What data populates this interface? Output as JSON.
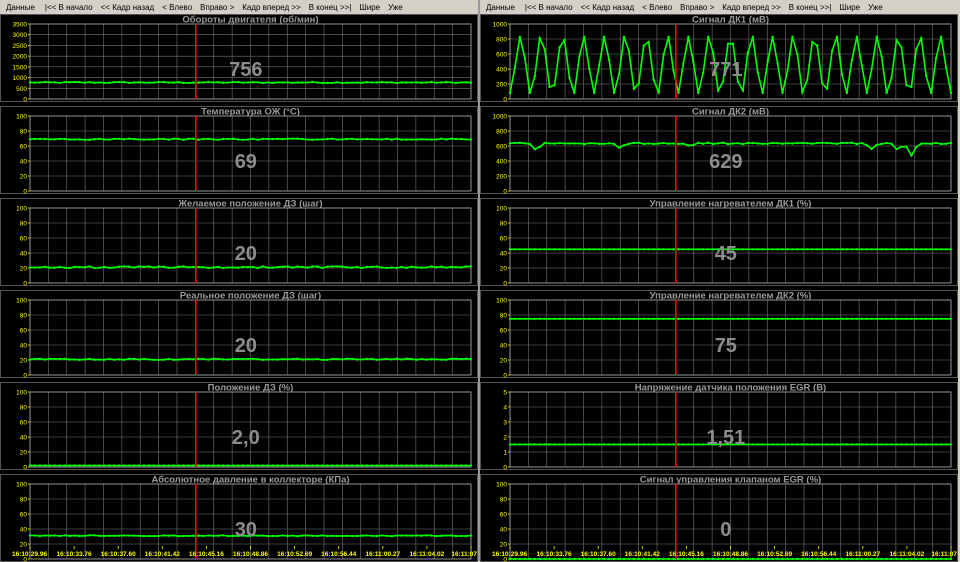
{
  "toolbar": {
    "items": [
      "Данные",
      "|<< В начало",
      "<< Кадр назад",
      "< Влево",
      "Вправо >",
      "Кадр вперед >>",
      "В конец >>|",
      "Шире",
      "Уже"
    ]
  },
  "time_axis": {
    "labels": [
      "16:10:29.96",
      "16:10:33.76",
      "16:10:37.60",
      "16:10:41.42",
      "16:10:45.16",
      "16:10:48.86",
      "16:10:52.69",
      "16:10:56.44",
      "16:11:00.27",
      "16:11:04.02",
      "16:11:07"
    ]
  },
  "cursor": {
    "position": 0.376,
    "color": "#ff0000"
  },
  "colors": {
    "trace": "#00ff00",
    "value": "#8c8c8c",
    "title": "#9a9a9a",
    "grid": "#777777",
    "tick": "#ffff00"
  },
  "chart_data": [
    {
      "id": "rpm",
      "type": "line",
      "title": "Обороты двигателя  (об/мин)",
      "value_text": "756",
      "ylim": [
        0,
        3500
      ],
      "yticks": [
        "3500",
        "3000",
        "2500",
        "2000",
        "1500",
        "1000",
        "500",
        "0"
      ],
      "grid": true,
      "pattern": "flat",
      "level": 770,
      "noise": 25
    },
    {
      "id": "coolant",
      "type": "line",
      "title": "Температура ОЖ  (°С)",
      "value_text": "69",
      "ylim": [
        0,
        100
      ],
      "yticks": [
        "100",
        "80",
        "60",
        "40",
        "20",
        "0"
      ],
      "grid": true,
      "pattern": "flat",
      "level": 69,
      "noise": 0.8
    },
    {
      "id": "dz-desired",
      "type": "line",
      "title": "Желаемое положение ДЗ  (шаг)",
      "value_text": "20",
      "ylim": [
        0,
        100
      ],
      "yticks": [
        "100",
        "80",
        "60",
        "40",
        "20",
        "0"
      ],
      "grid": true,
      "pattern": "flat",
      "level": 21,
      "noise": 1.2
    },
    {
      "id": "dz-actual",
      "type": "line",
      "title": "Реальное положение ДЗ  (шаг)",
      "value_text": "20",
      "ylim": [
        0,
        100
      ],
      "yticks": [
        "100",
        "80",
        "60",
        "40",
        "20",
        "0"
      ],
      "grid": true,
      "pattern": "flat",
      "level": 21,
      "noise": 0.8
    },
    {
      "id": "dz-position",
      "type": "line",
      "title": "Положение ДЗ  (%)",
      "value_text": "2,0",
      "ylim": [
        0,
        100
      ],
      "yticks": [
        "100",
        "80",
        "60",
        "40",
        "20",
        "0"
      ],
      "grid": true,
      "pattern": "flat",
      "level": 2,
      "noise": 0
    },
    {
      "id": "map",
      "type": "line",
      "title": "Абсолютное давление в коллекторе  (КПа)",
      "value_text": "30",
      "ylim": [
        0,
        100
      ],
      "yticks": [
        "100",
        "80",
        "60",
        "40",
        "20",
        "0"
      ],
      "grid": true,
      "pattern": "flat",
      "level": 31,
      "noise": 0.6
    },
    {
      "id": "o2-1",
      "type": "line",
      "title": "Сигнал ДК1  (мВ)",
      "value_text": "771",
      "ylim": [
        0,
        1000
      ],
      "yticks": [
        "1000",
        "800",
        "600",
        "400",
        "200",
        "0"
      ],
      "grid": true,
      "pattern": "oscillate",
      "low": 80,
      "high": 830,
      "cycles": 21
    },
    {
      "id": "o2-2",
      "type": "line",
      "title": "Сигнал ДК2  (мВ)",
      "value_text": "629",
      "ylim": [
        0,
        1000
      ],
      "yticks": [
        "1000",
        "800",
        "600",
        "400",
        "200",
        "0"
      ],
      "grid": true,
      "pattern": "flat_dips",
      "level": 635,
      "noise": 10,
      "dips": [
        [
          0.06,
          100
        ],
        [
          0.25,
          70
        ],
        [
          0.41,
          50
        ],
        [
          0.82,
          70
        ],
        [
          0.88,
          110
        ],
        [
          0.91,
          160
        ]
      ]
    },
    {
      "id": "heater-1",
      "type": "line",
      "title": "Управление нагревателем ДК1  (%)",
      "value_text": "45",
      "ylim": [
        0,
        100
      ],
      "yticks": [
        "100",
        "80",
        "60",
        "40",
        "20",
        "0"
      ],
      "grid": true,
      "pattern": "flat",
      "level": 45,
      "noise": 0
    },
    {
      "id": "heater-2",
      "type": "line",
      "title": "Управление нагревателем ДК2  (%)",
      "value_text": "75",
      "ylim": [
        0,
        100
      ],
      "yticks": [
        "100",
        "80",
        "60",
        "40",
        "20",
        "0"
      ],
      "grid": true,
      "pattern": "flat",
      "level": 75,
      "noise": 0
    },
    {
      "id": "egr-voltage",
      "type": "line",
      "title": "Напряжение датчика положения EGR  (В)",
      "value_text": "1,51",
      "ylim": [
        0,
        5
      ],
      "yticks": [
        "5",
        "4",
        "3",
        "2",
        "1",
        "0"
      ],
      "grid": true,
      "pattern": "flat",
      "level": 1.51,
      "noise": 0
    },
    {
      "id": "egr-control",
      "type": "line",
      "title": "Сигнал управления клапаном EGR  (%)",
      "value_text": "0",
      "ylim": [
        0,
        100
      ],
      "yticks": [
        "100",
        "80",
        "60",
        "40",
        "20",
        "0"
      ],
      "grid": true,
      "pattern": "flat",
      "level": 0,
      "noise": 0
    }
  ]
}
